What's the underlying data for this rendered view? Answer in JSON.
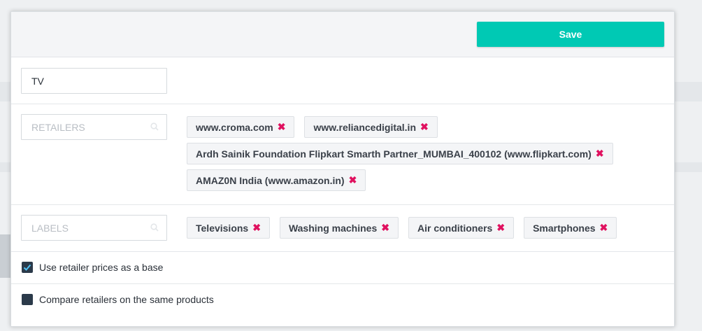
{
  "modal": {
    "save_label": "Save",
    "name_value": "TV",
    "retailers": {
      "placeholder": "RETAILERS",
      "tags": [
        "www.croma.com",
        "www.reliancedigital.in",
        "Ardh Sainik Foundation Flipkart Smarth Partner_MUMBAI_400102 (www.flipkart.com)",
        "AMAZ0N India (www.amazon.in)"
      ]
    },
    "labels": {
      "placeholder": "LABELS",
      "tags": [
        "Televisions",
        "Washing machines",
        "Air conditioners",
        "Smartphones"
      ]
    },
    "options": [
      {
        "label": "Use retailer prices as a base",
        "checked": true
      },
      {
        "label": "Compare retailers on the same products",
        "checked": false
      }
    ]
  },
  "colors": {
    "accent": "#00c9b4",
    "remove": "#e0115f",
    "checkbox": "#2b3a4a"
  }
}
